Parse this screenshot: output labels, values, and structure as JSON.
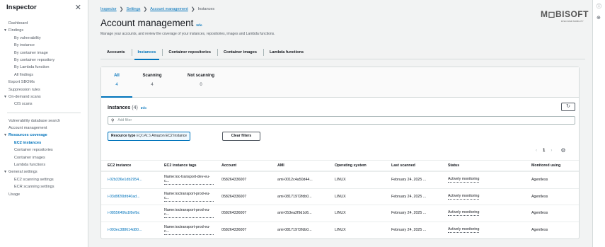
{
  "sidebar": {
    "title": "Inspector",
    "close": "✕",
    "items": [
      {
        "label": "Dashboard",
        "level": 0
      },
      {
        "label": "Findings",
        "level": 0,
        "caret": "▼"
      },
      {
        "label": "By vulnerability",
        "level": 1
      },
      {
        "label": "By instance",
        "level": 1
      },
      {
        "label": "By container image",
        "level": 1
      },
      {
        "label": "By container repository",
        "level": 1
      },
      {
        "label": "By Lambda function",
        "level": 1
      },
      {
        "label": "All findings",
        "level": 1
      },
      {
        "label": "Export SBOMs",
        "level": 0
      },
      {
        "label": "Suppression rules",
        "level": 0
      },
      {
        "label": "On-demand scans",
        "level": 0,
        "caret": "▼"
      },
      {
        "label": "CIS scans",
        "level": 1
      }
    ],
    "items2": [
      {
        "label": "Vulnerability database search",
        "level": 0
      },
      {
        "label": "Account management",
        "level": 0
      },
      {
        "label": "Resources coverage",
        "level": 0,
        "caret": "▼",
        "section": true
      },
      {
        "label": "EC2 instances",
        "level": 1,
        "active": true
      },
      {
        "label": "Container repositories",
        "level": 1
      },
      {
        "label": "Container images",
        "level": 1
      },
      {
        "label": "Lambda functions",
        "level": 1
      },
      {
        "label": "General settings",
        "level": 0,
        "caret": "▼"
      },
      {
        "label": "EC2 scanning settings",
        "level": 1
      },
      {
        "label": "ECR scanning settings",
        "level": 1
      },
      {
        "label": "Usage",
        "level": 0
      }
    ]
  },
  "rail": {
    "icon1": "ⓘ",
    "icon2": "⊕"
  },
  "breadcrumb": {
    "items": [
      "Inspector",
      "Settings",
      "Account management"
    ],
    "current": "Instances",
    "sep": "❯"
  },
  "header": {
    "title": "Account management",
    "info": "Info",
    "subtitle": "Manage your accounts, and review the coverage of your instances, repositories, images and Lambda functions."
  },
  "logo": {
    "text": "M◻BISOFT",
    "tagline": "DISCOVER MOBILITY"
  },
  "tabs": [
    "Accounts",
    "Instances",
    "Container repositories",
    "Container images",
    "Lambda functions"
  ],
  "stats": [
    {
      "label": "All",
      "value": "4"
    },
    {
      "label": "Scanning",
      "value": "4"
    },
    {
      "label": "Not scanning",
      "value": "0"
    }
  ],
  "instances": {
    "heading": "Instances",
    "count": "(4)",
    "info": "Info",
    "refresh": "↻",
    "search_placeholder": "Add filter",
    "search_icon": "⚲",
    "token_key": "Resource type",
    "token_op": "EQUALS",
    "token_val": "Amazon EC2 Instance",
    "clear": "Clear filters",
    "pager": {
      "prev": "‹",
      "page": "1",
      "next": "›",
      "gear": "⚙"
    }
  },
  "table": {
    "headers": [
      "EC2 instance",
      "EC2 instance tags",
      "Account",
      "AMI",
      "Operating system",
      "Last scanned",
      "Status",
      "Monitored using"
    ],
    "rows": [
      {
        "id": "i-02b336e1db2954...",
        "tags": "Name:ioc-transport-dev-eu-c...",
        "account": "058264336007",
        "ami": "ami-0012c4a50d44...",
        "os": "LINUX",
        "scanned": "February 24, 2025 ...",
        "status": "Actively monitoring",
        "monitored": "Agentless"
      },
      {
        "id": "i-03d9f20bfd40ad...",
        "tags": "Name:ioctransport-prod-eu-c...",
        "account": "058264336007",
        "ami": "ami-08171972fdb0...",
        "os": "LINUX",
        "scanned": "February 24, 2025 ...",
        "status": "Actively monitoring",
        "monitored": "Agentless"
      },
      {
        "id": "i-0855649fa1f8efbc",
        "tags": "Name:ioctransport-prod-eu-c...",
        "account": "058264336007",
        "ami": "ami-053ea2f9d1d6...",
        "os": "LINUX",
        "scanned": "February 24, 2025 ...",
        "status": "Actively monitoring",
        "monitored": "Agentless"
      },
      {
        "id": "i-093ec388614d80...",
        "tags": "Name:ioctransport-prod-eu-c...",
        "account": "058264336007",
        "ami": "ami-08171972fdb0...",
        "os": "LINUX",
        "scanned": "February 24, 2025 ...",
        "status": "Actively monitoring",
        "monitored": "Agentless"
      }
    ]
  }
}
